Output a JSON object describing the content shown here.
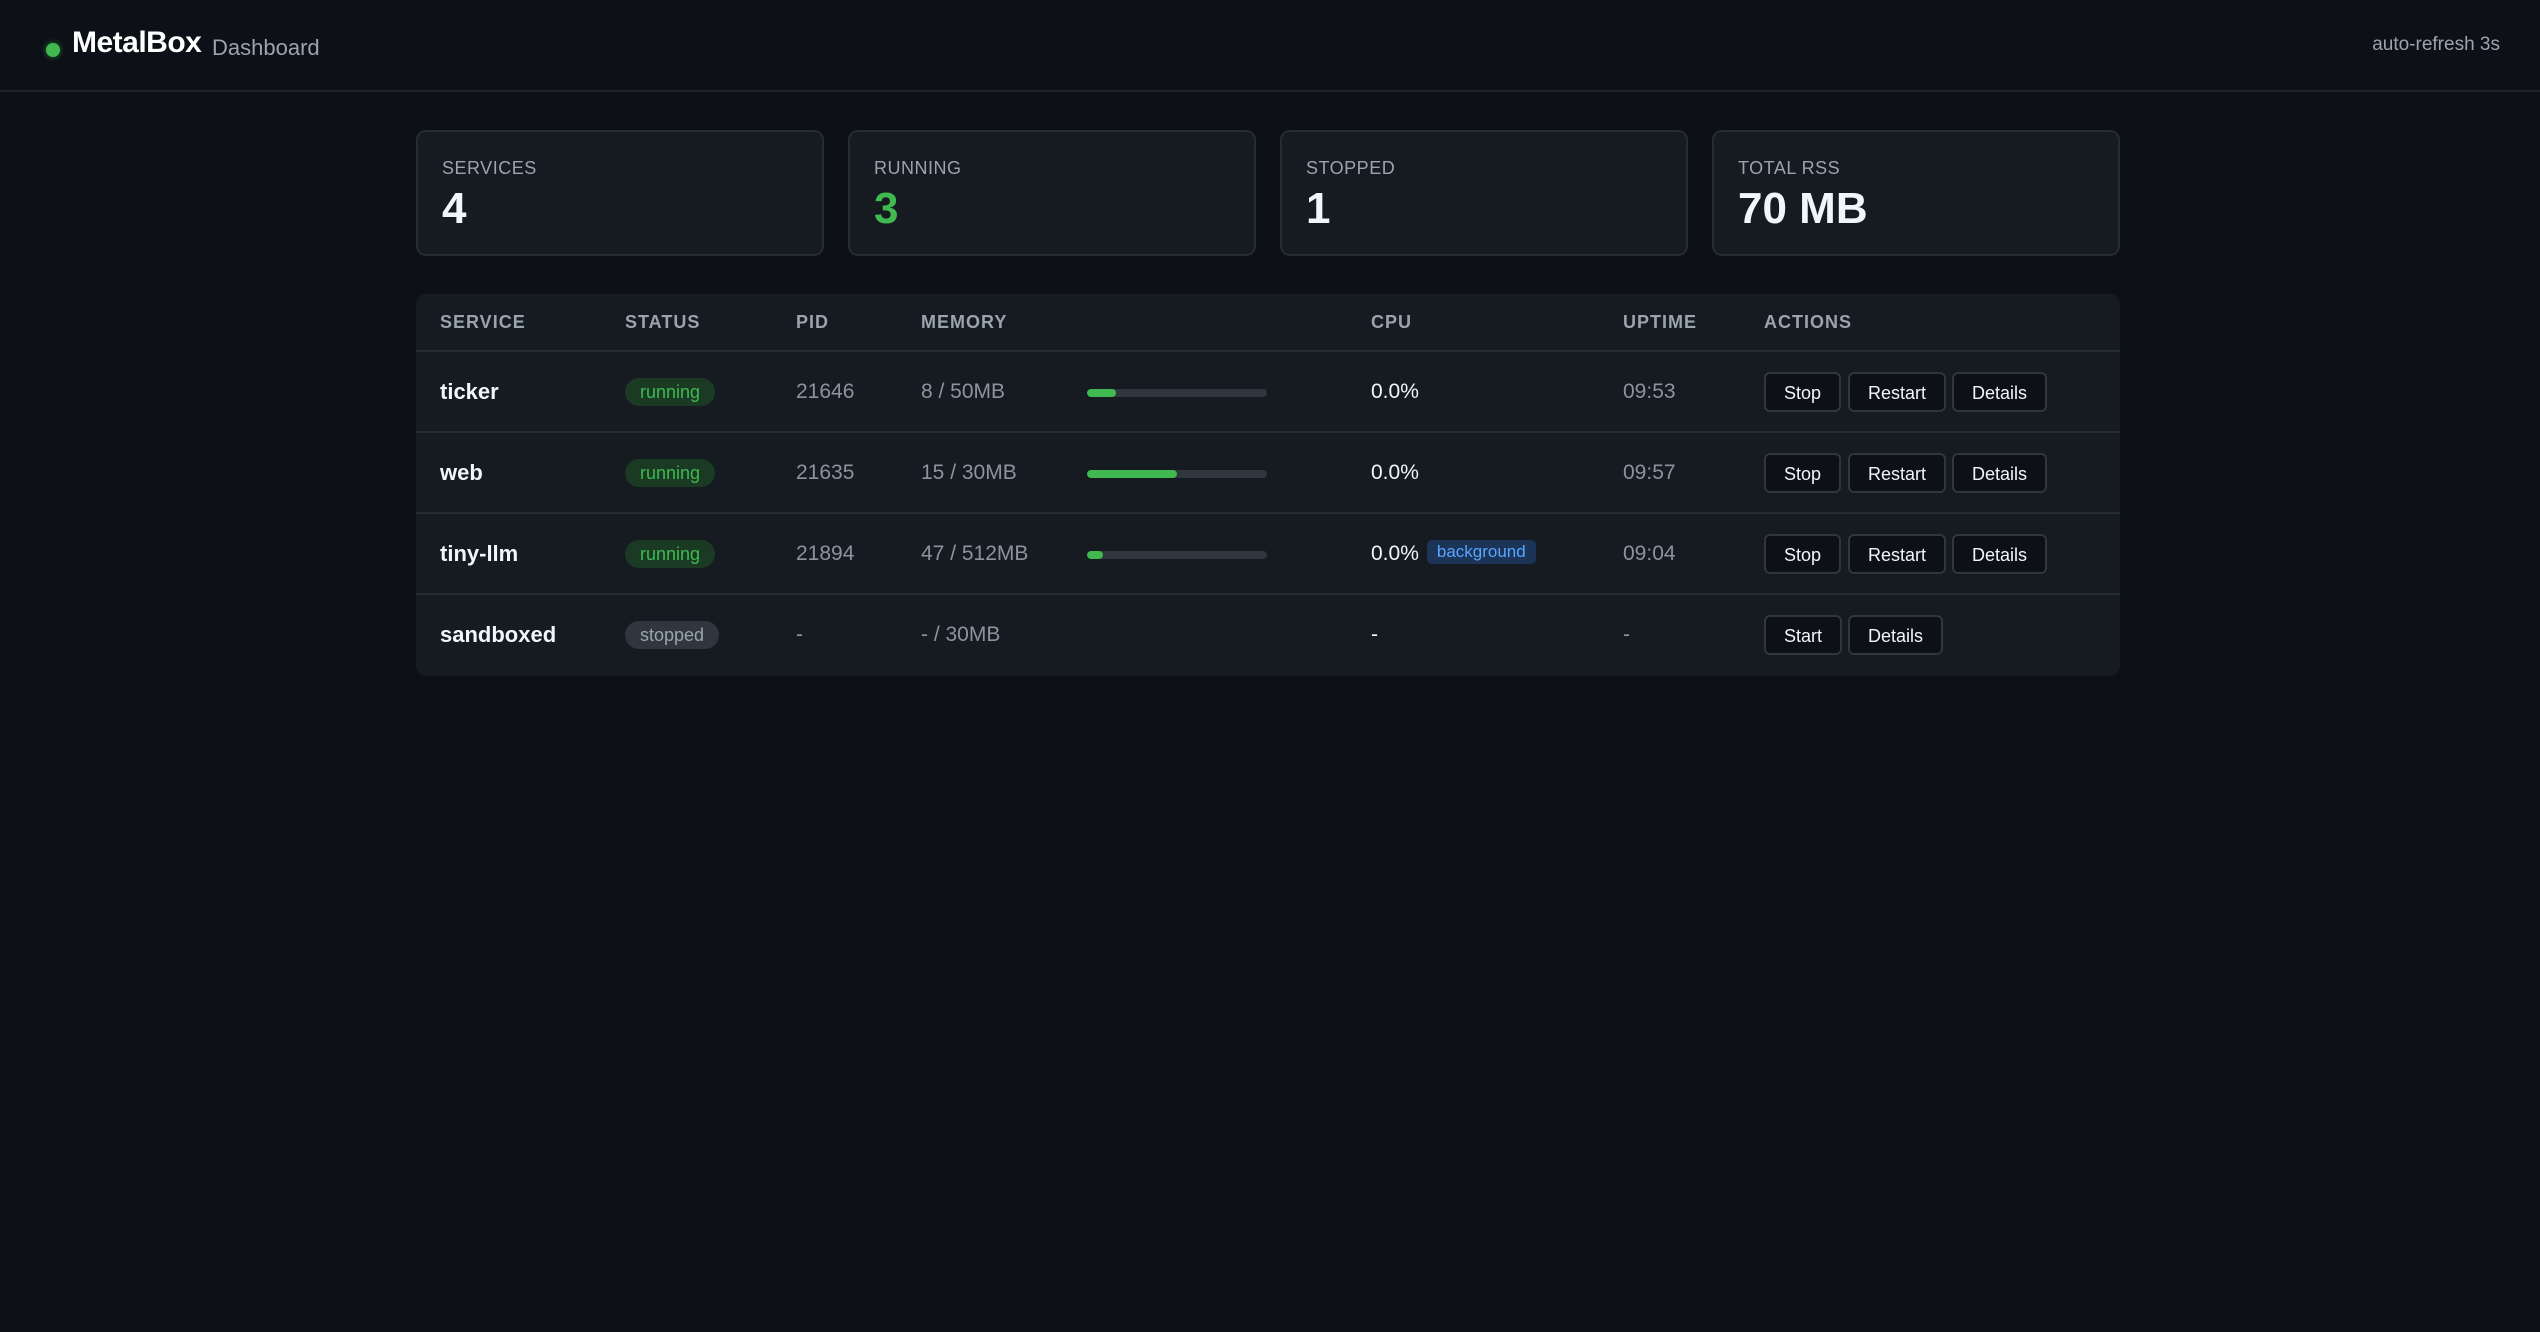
{
  "header": {
    "brand": "MetalBox",
    "subtitle": "Dashboard",
    "refresh": "auto-refresh 3s",
    "status_color": "#3fb950"
  },
  "stats": [
    {
      "label": "SERVICES",
      "value": "4"
    },
    {
      "label": "RUNNING",
      "value": "3",
      "color": "#3fb950"
    },
    {
      "label": "STOPPED",
      "value": "1"
    },
    {
      "label": "TOTAL RSS",
      "value": "70 MB"
    }
  ],
  "table": {
    "headers": {
      "service": "SERVICE",
      "status": "STATUS",
      "pid": "PID",
      "memory": "MEMORY",
      "cpu": "CPU",
      "uptime": "UPTIME",
      "actions": "ACTIONS"
    },
    "rows": [
      {
        "service": "ticker",
        "status": "running",
        "pid": "21646",
        "memory": "8 / 50MB",
        "mem_fraction": 0.16,
        "cpu": "0.0%",
        "uptime": "09:53",
        "actions": [
          "Stop",
          "Restart",
          "Details"
        ]
      },
      {
        "service": "web",
        "status": "running",
        "pid": "21635",
        "memory": "15 / 30MB",
        "mem_fraction": 0.5,
        "cpu": "0.0%",
        "uptime": "09:57",
        "actions": [
          "Stop",
          "Restart",
          "Details"
        ]
      },
      {
        "service": "tiny-llm",
        "status": "running",
        "pid": "21894",
        "memory": "47 / 512MB",
        "mem_fraction": 0.09,
        "cpu": "0.0%",
        "cpu_tag": "background",
        "uptime": "09:04",
        "actions": [
          "Stop",
          "Restart",
          "Details"
        ]
      },
      {
        "service": "sandboxed",
        "status": "stopped",
        "pid": "-",
        "memory": "- / 30MB",
        "cpu": "-",
        "uptime": "-",
        "actions": [
          "Start",
          "Details"
        ]
      }
    ]
  },
  "colors": {
    "background": "#0d1117",
    "card": "#161b22",
    "running": "#3fb950",
    "tag": "#58a6ff"
  }
}
